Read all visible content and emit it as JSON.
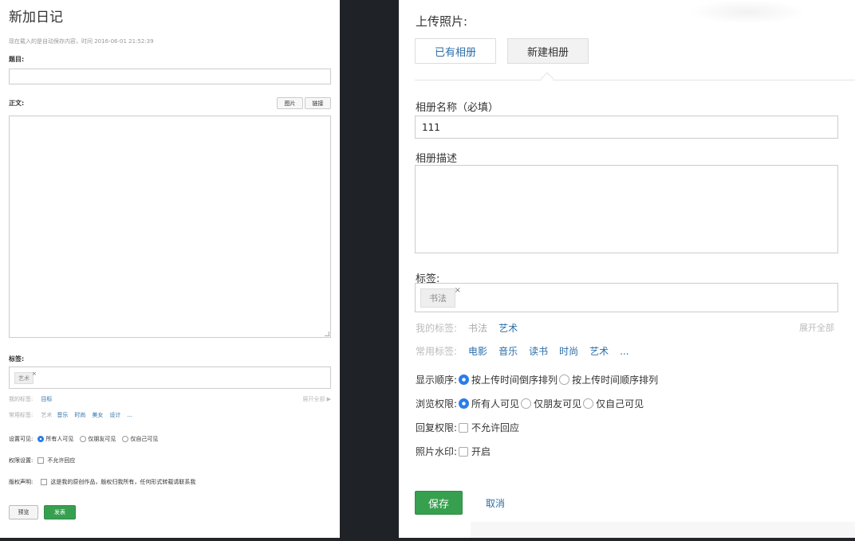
{
  "left": {
    "title": "新加日记",
    "autosave": "现在载入的是自动保存内容，时间 2016-06-01 21:52:39",
    "subject_label": "题目:",
    "body_label": "正文:",
    "photo_button": "图片",
    "link_button": "链接",
    "tags_label": "标签:",
    "tag": "艺术",
    "tag_remove": "×",
    "my_tags_label": "我的标签:",
    "my_tags": [
      "目标"
    ],
    "expand_all": "展开全部 ▶",
    "common_tags_label": "常用标签:",
    "common_tags_gray": "艺术",
    "common_tags": [
      "音乐",
      "时尚",
      "美女",
      "设计",
      "..."
    ],
    "visibility_label": "设置可见:",
    "visibility_options": [
      "所有人可见",
      "仅朋友可见",
      "仅自己可见"
    ],
    "permission_label": "权限设置:",
    "no_reply": "不允许回应",
    "copyright_label": "版权声明:",
    "copyright_text": "这是我的原创作品，版权归我所有，任何形式转载请联系我",
    "preview_button": "预览",
    "publish_button": "发表"
  },
  "right": {
    "title": "上传照片:",
    "tab_existing": "已有相册",
    "tab_new": "新建相册",
    "album_name_label": "相册名称（必填）",
    "album_name_value": "111",
    "album_desc_label": "相册描述",
    "tags_label": "标签:",
    "tag": "书法",
    "tag_remove": "×",
    "my_tags_label": "我的标签:",
    "my_tags_gray": "书法",
    "my_tags": [
      "艺术"
    ],
    "expand_all": "展开全部",
    "common_tags_label": "常用标签:",
    "common_tags": [
      "电影",
      "音乐",
      "读书",
      "时尚",
      "艺术",
      "..."
    ],
    "order_label": "显示顺序:",
    "order_options": [
      "按上传时间倒序排列",
      "按上传时间顺序排列"
    ],
    "view_label": "浏览权限:",
    "view_options": [
      "所有人可见",
      "仅朋友可见",
      "仅自己可见"
    ],
    "reply_label": "回复权限:",
    "no_reply": "不允许回应",
    "watermark_label": "照片水印:",
    "watermark_option": "开启",
    "save_button": "保存",
    "cancel_link": "取消"
  }
}
